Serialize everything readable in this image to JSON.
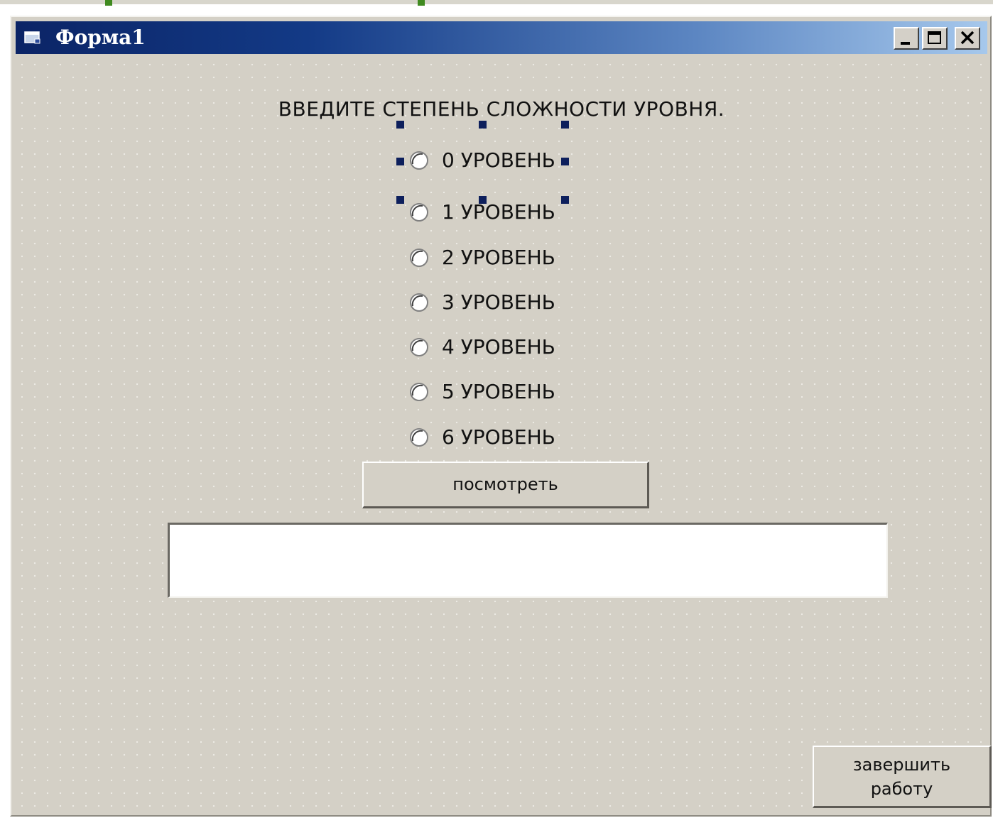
{
  "window": {
    "title": "Форма1",
    "controls": {
      "minimize": "minimize",
      "maximize": "maximize",
      "close": "close"
    }
  },
  "form": {
    "prompt": "ВВЕДИТЕ СТЕПЕНЬ СЛОЖНОСТИ УРОВНЯ.",
    "levels": [
      {
        "label": "0 УРОВЕНЬ",
        "selected_in_designer": true
      },
      {
        "label": "1 УРОВЕНЬ",
        "selected_in_designer": false
      },
      {
        "label": "2 УРОВЕНЬ",
        "selected_in_designer": false
      },
      {
        "label": "3 УРОВЕНЬ",
        "selected_in_designer": false
      },
      {
        "label": "4 УРОВЕНЬ",
        "selected_in_designer": false
      },
      {
        "label": "5 УРОВЕНЬ",
        "selected_in_designer": false
      },
      {
        "label": "6 УРОВЕНЬ",
        "selected_in_designer": false
      }
    ],
    "view_button": "посмотреть",
    "output_value": "",
    "finish_button_line1": "завершить",
    "finish_button_line2": "работу"
  },
  "colors": {
    "titlebar_start": "#0b2466",
    "titlebar_end": "#a6c8ec",
    "form_background": "#d4d0c6",
    "selection_handle": "#0d1f5c",
    "accent_green": "#3f8a1f"
  },
  "icons": [
    "form-icon",
    "minimize-icon",
    "maximize-icon",
    "close-icon",
    "radio-icon"
  ]
}
